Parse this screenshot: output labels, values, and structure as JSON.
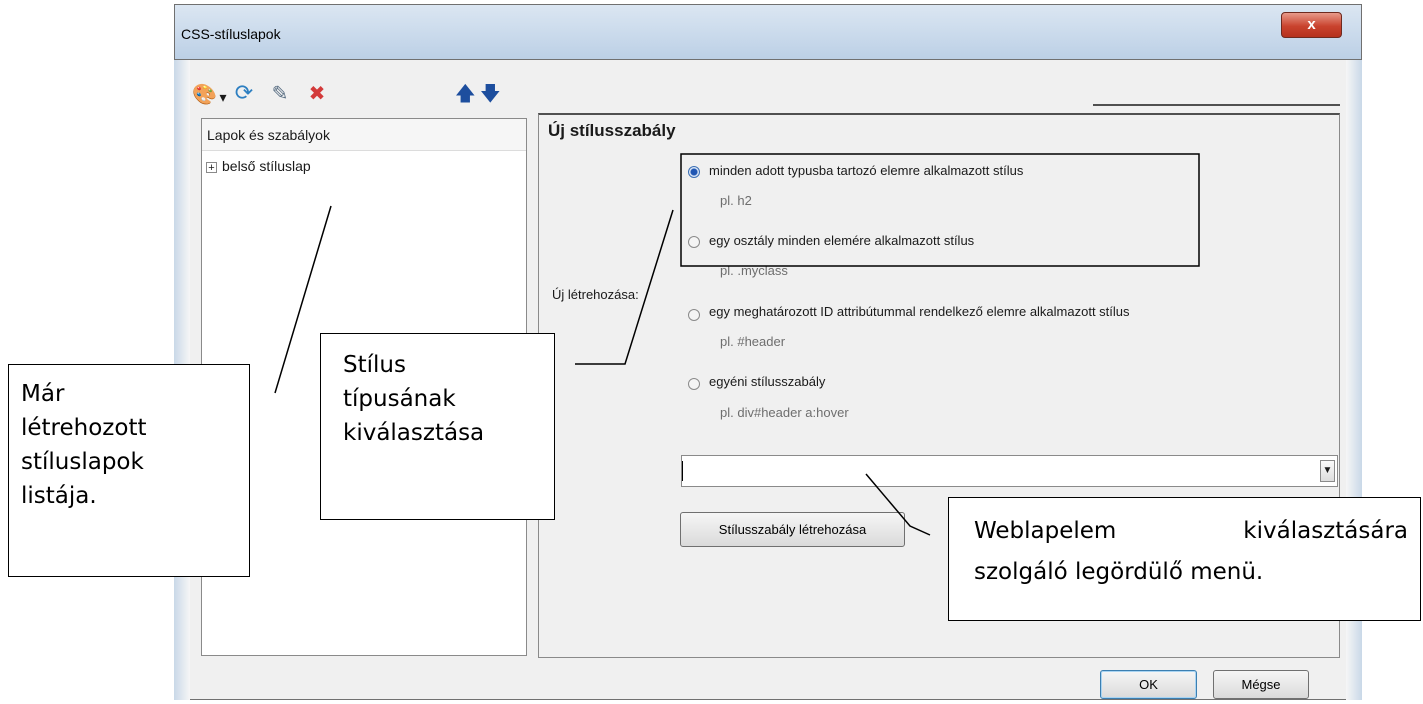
{
  "dialog": {
    "title": "CSS-stíluslapok",
    "close_label": "x",
    "toolbar_icons": [
      "palette-icon",
      "dropdown-arrow-icon",
      "refresh-icon",
      "edit-icon",
      "delete-icon",
      "move-up-icon",
      "move-down-icon"
    ],
    "toolbar_glyphs": {
      "palette": "🎨",
      "arrow": "▾",
      "refresh": "⟳",
      "edit": "✎",
      "delete": "✖",
      "up": "🡅",
      "down": "🡇"
    }
  },
  "left_panel": {
    "header": "Lapok és szabályok",
    "items": [
      {
        "label": "belső stíluslap",
        "expander": "+"
      }
    ]
  },
  "right_panel": {
    "title": "Új stílusszabály",
    "create_label": "Új létrehozása:",
    "options": [
      {
        "label": "minden adott typusba tartozó elemre alkalmazott stílus",
        "hint": "pl. h2",
        "selected": true
      },
      {
        "label": "egy osztály minden elemére alkalmazott stílus",
        "hint": "pl. .myclass",
        "selected": false
      },
      {
        "label": "egy meghatározott ID attribútummal rendelkező elemre alkalmazott stílus",
        "hint": "pl. #header",
        "selected": false
      },
      {
        "label": "egyéni stílusszabály",
        "hint": "pl. div#header a:hover",
        "selected": false
      }
    ],
    "combo_value": "",
    "combo_arrow": "▼",
    "create_button": "Stílusszabály létrehozása"
  },
  "footer": {
    "ok": "OK",
    "cancel": "Mégse"
  },
  "annotations": {
    "list": [
      "Már",
      "létrehozott",
      "stíluslapok",
      "listája."
    ],
    "type": [
      "Stílus",
      "típusának",
      "kiválasztása"
    ],
    "menu_line1_a": "Weblapelem",
    "menu_line1_b": "kiválasztására",
    "menu_line2": "szolgáló legördülő menü."
  }
}
